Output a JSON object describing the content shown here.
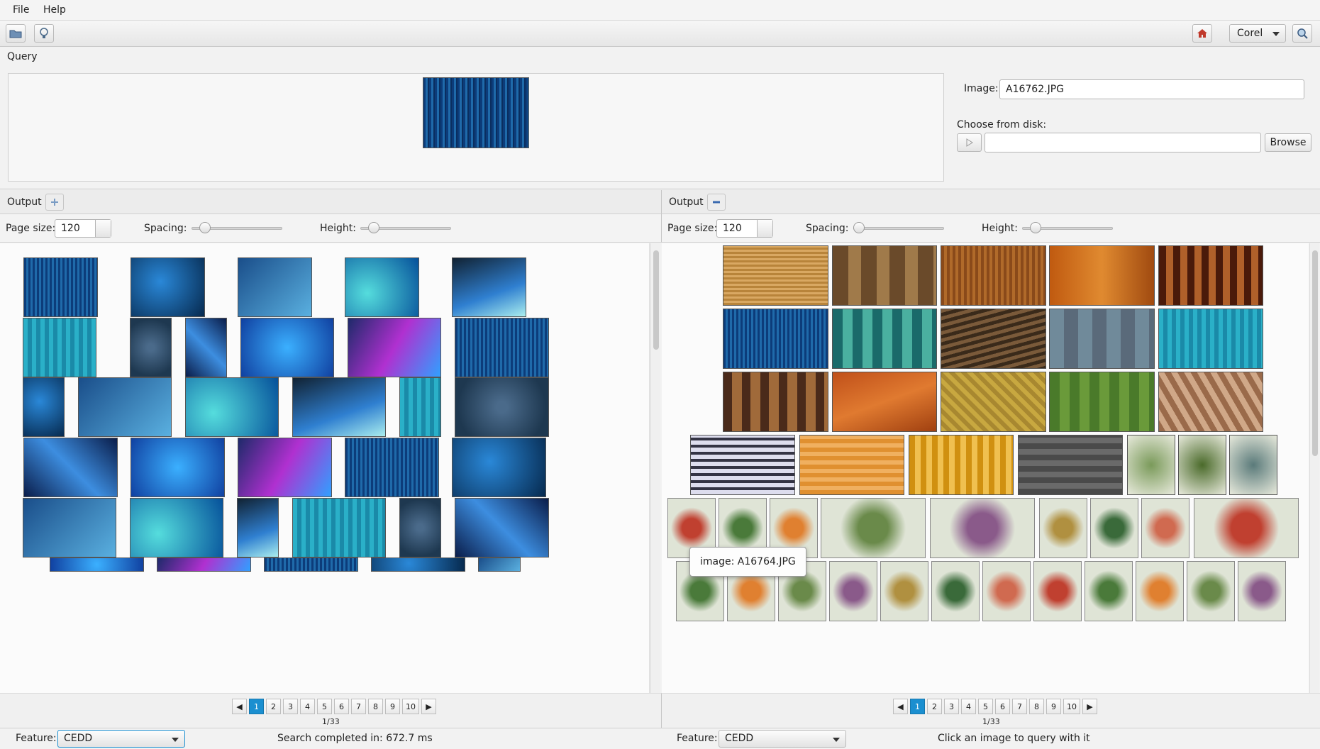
{
  "menu": {
    "file": "File",
    "help": "Help"
  },
  "toolbar": {
    "open_icon": "folder-icon",
    "idea_icon": "lightbulb-icon",
    "home_icon": "home-icon",
    "dataset": "Corel",
    "search_icon": "search-icon"
  },
  "query": {
    "title": "Query",
    "image_label": "Image:",
    "image_value": "A16762.JPG",
    "choose_label": "Choose from disk:",
    "path_value": "",
    "browse_label": "Browse"
  },
  "left": {
    "title": "Output",
    "toggle_icon": "plus-icon",
    "page_size_label": "Page size:",
    "page_size_value": "120",
    "spacing_label": "Spacing:",
    "height_label": "Height:",
    "spacing_level": 0.1,
    "height_level": 0.1,
    "pages": [
      "1",
      "2",
      "3",
      "4",
      "5",
      "6",
      "7",
      "8",
      "9",
      "10"
    ],
    "page_info": "1/33",
    "feature_label": "Feature:",
    "feature_value": "CEDD",
    "status": "Search completed in: 672.7 ms"
  },
  "right": {
    "title": "Output",
    "toggle_icon": "minus-icon",
    "page_size_label": "Page size:",
    "page_size_value": "120",
    "spacing_label": "Spacing:",
    "height_label": "Height:",
    "spacing_level": 0.0,
    "height_level": 0.1,
    "pages": [
      "1",
      "2",
      "3",
      "4",
      "5",
      "6",
      "7",
      "8",
      "9",
      "10"
    ],
    "page_info": "1/33",
    "feature_label": "Feature:",
    "feature_value": "CEDD",
    "status": "Click an image to query with it",
    "tooltip": "image: A16764.JPG"
  },
  "colors": {
    "accent": "#1b8fd0"
  }
}
